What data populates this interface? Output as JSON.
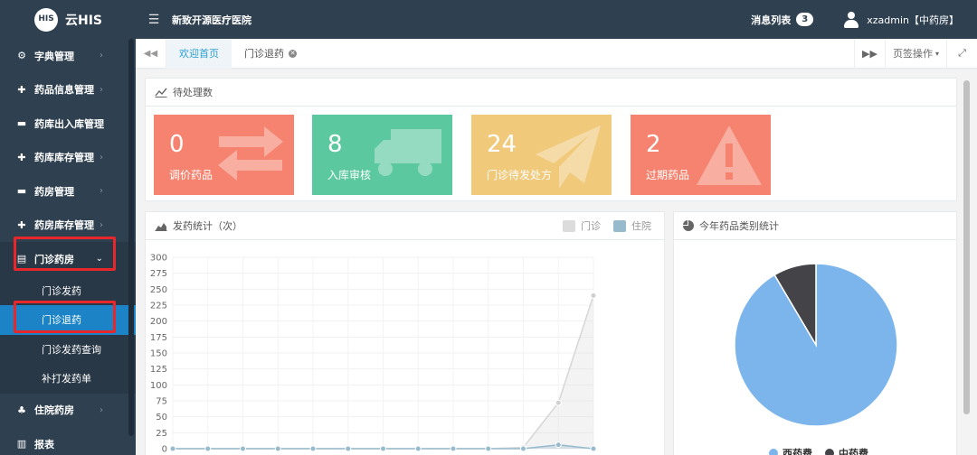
{
  "header": {
    "logo_badge": "云HIS",
    "logo_text": "云HIS",
    "hospital_name": "新致开源医疗医院",
    "messages_label": "消息列表",
    "messages_count": "3",
    "user_label": "xzadmin【中药房】"
  },
  "sidebar": {
    "items": [
      {
        "label": "字典管理"
      },
      {
        "label": "药品信息管理"
      },
      {
        "label": "药库出入库管理"
      },
      {
        "label": "药库库存管理"
      },
      {
        "label": "药房管理"
      },
      {
        "label": "药房库存管理"
      },
      {
        "label": "门诊药房"
      },
      {
        "label": "住院药房"
      },
      {
        "label": "报表"
      }
    ],
    "submenu": [
      {
        "label": "门诊发药"
      },
      {
        "label": "门诊退药"
      },
      {
        "label": "门诊发药查询"
      },
      {
        "label": "补打发药单"
      }
    ]
  },
  "tabs": {
    "items": [
      {
        "label": "欢迎首页"
      },
      {
        "label": "门诊退药"
      }
    ],
    "page_ops_label": "页签操作"
  },
  "pending": {
    "title": "待处理数",
    "cards": [
      {
        "value": "0",
        "label": "调价药品",
        "color": "#f5836f"
      },
      {
        "value": "8",
        "label": "入库审核",
        "color": "#5cc8a0"
      },
      {
        "value": "24",
        "label": "门诊待发处方",
        "color": "#f0c97a"
      },
      {
        "value": "2",
        "label": "过期药品",
        "color": "#f5836f"
      }
    ]
  },
  "dispense_chart": {
    "title": "发药统计（次）",
    "legend": [
      {
        "name": "门诊",
        "color": "#dcdcdc"
      },
      {
        "name": "住院",
        "color": "#97bbcd"
      }
    ]
  },
  "category_chart": {
    "title": "今年药品类别统计",
    "legend": [
      {
        "name": "西药费",
        "color": "#7cb5ec"
      },
      {
        "name": "中药费",
        "color": "#434348"
      }
    ]
  },
  "chart_data": [
    {
      "type": "area",
      "title": "发药统计（次）",
      "ylim": [
        0,
        300
      ],
      "yticks": [
        0,
        25,
        50,
        75,
        100,
        125,
        150,
        175,
        200,
        225,
        250,
        275,
        300
      ],
      "series": [
        {
          "name": "门诊",
          "values": [
            0,
            0,
            0,
            0,
            0,
            0,
            0,
            0,
            0,
            0,
            2,
            72,
            240
          ]
        },
        {
          "name": "住院",
          "values": [
            0,
            0,
            0,
            0,
            0,
            0,
            0,
            0,
            0,
            0,
            0,
            6,
            0
          ]
        }
      ],
      "grid": true,
      "legend_position": "top-right"
    },
    {
      "type": "pie",
      "title": "今年药品类别统计",
      "categories": [
        "西药费",
        "中药费"
      ],
      "values": [
        91.5,
        8.5
      ],
      "legend_position": "bottom"
    }
  ]
}
